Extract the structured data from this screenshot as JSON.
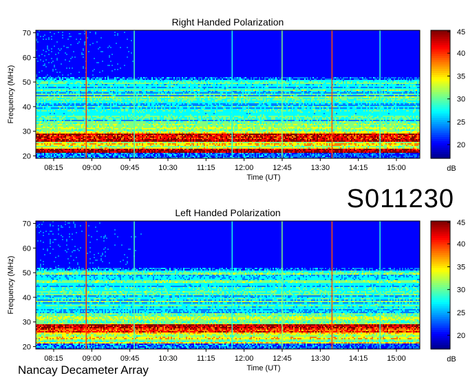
{
  "chart_data": [
    {
      "type": "heatmap",
      "title": "Right Handed Polarization",
      "xlabel": "Time (UT)",
      "ylabel": "Frequency (MHz)",
      "x_ticks": [
        "08:15",
        "09:00",
        "09:45",
        "10:30",
        "11:15",
        "12:00",
        "12:45",
        "13:30",
        "14:15",
        "15:00"
      ],
      "y_ticks": [
        20,
        30,
        40,
        50,
        60,
        70
      ],
      "ylim": [
        19,
        71
      ],
      "colorbar": {
        "label": "dB",
        "ticks": [
          20,
          25,
          30,
          35,
          40,
          45
        ],
        "range": [
          17,
          45
        ]
      },
      "bands_mhz": [
        {
          "freq": [
            25.5,
            29
          ],
          "level": "strong"
        },
        {
          "freq": [
            21,
            23
          ],
          "level": "strong"
        },
        {
          "freq": [
            23,
            25.5
          ],
          "level": "medium"
        },
        {
          "freq": [
            29,
            33
          ],
          "level": "medium"
        },
        {
          "freq": [
            33,
            45
          ],
          "level": "weak"
        },
        {
          "freq": [
            45,
            51
          ],
          "level": "weak"
        }
      ],
      "colormap": "jet"
    },
    {
      "type": "heatmap",
      "title": "Left Handed Polarization",
      "xlabel": "Time (UT)",
      "ylabel": "Frequency (MHz)",
      "x_ticks": [
        "08:15",
        "09:00",
        "09:45",
        "10:30",
        "11:15",
        "12:00",
        "12:45",
        "13:30",
        "14:15",
        "15:00"
      ],
      "y_ticks": [
        20,
        30,
        40,
        50,
        60,
        70
      ],
      "ylim": [
        19,
        71
      ],
      "colorbar": {
        "label": "dB",
        "ticks": [
          20,
          25,
          30,
          35,
          40,
          45
        ],
        "range": [
          17,
          45
        ]
      },
      "bands_mhz": [
        {
          "freq": [
            25.5,
            29
          ],
          "level": "strong"
        },
        {
          "freq": [
            21,
            23
          ],
          "level": "medium"
        },
        {
          "freq": [
            23,
            25.5
          ],
          "level": "medium"
        },
        {
          "freq": [
            29,
            33
          ],
          "level": "medium"
        },
        {
          "freq": [
            33,
            45
          ],
          "level": "weak"
        },
        {
          "freq": [
            45,
            51
          ],
          "level": "weak"
        }
      ],
      "colormap": "jet"
    }
  ],
  "labels": {
    "observation_id": "S011230",
    "instrument": "Nancay Decameter Array"
  }
}
